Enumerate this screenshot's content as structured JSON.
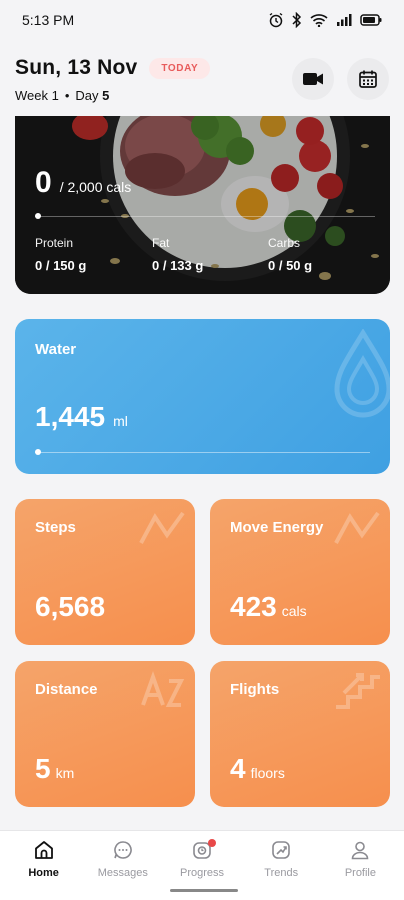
{
  "status_bar": {
    "time": "5:13 PM",
    "icons": [
      "alarm-icon",
      "bluetooth-icon",
      "wifi-icon",
      "signal-icon",
      "battery-icon"
    ]
  },
  "header": {
    "date": "Sun, 13 Nov",
    "today_badge": "TODAY",
    "week_label": "Week 1",
    "separator": "•",
    "day_label": "Day",
    "day_number": "5",
    "buttons": [
      "video-icon",
      "calendar-icon"
    ]
  },
  "nutrition": {
    "calories_value": "0",
    "calories_goal": "/ 2,000 cals",
    "calories_progress": 0,
    "macros": [
      {
        "label": "Protein",
        "value": "0 / 150 g"
      },
      {
        "label": "Fat",
        "value": "0 / 133 g"
      },
      {
        "label": "Carbs",
        "value": "0 / 50 g"
      }
    ]
  },
  "water": {
    "label": "Water",
    "value": "1,445",
    "unit": "ml",
    "progress": 0
  },
  "tiles": {
    "steps": {
      "label": "Steps",
      "value": "6,568",
      "unit": ""
    },
    "move_energy": {
      "label": "Move Energy",
      "value": "423",
      "unit": "cals"
    },
    "distance": {
      "label": "Distance",
      "value": "5",
      "unit": "km"
    },
    "flights": {
      "label": "Flights",
      "value": "4",
      "unit": "floors"
    }
  },
  "nav": {
    "items": [
      {
        "label": "Home",
        "icon": "home-icon",
        "active": true
      },
      {
        "label": "Messages",
        "icon": "messages-icon",
        "active": false
      },
      {
        "label": "Progress",
        "icon": "progress-icon",
        "active": false,
        "badge": true
      },
      {
        "label": "Trends",
        "icon": "trends-icon",
        "active": false
      },
      {
        "label": "Profile",
        "icon": "profile-icon",
        "active": false
      }
    ]
  },
  "colors": {
    "water_card": "#4aa9e6",
    "tile_orange": "#f69a5a",
    "today_badge_text": "#e85b5b",
    "nav_badge": "#e84848"
  }
}
